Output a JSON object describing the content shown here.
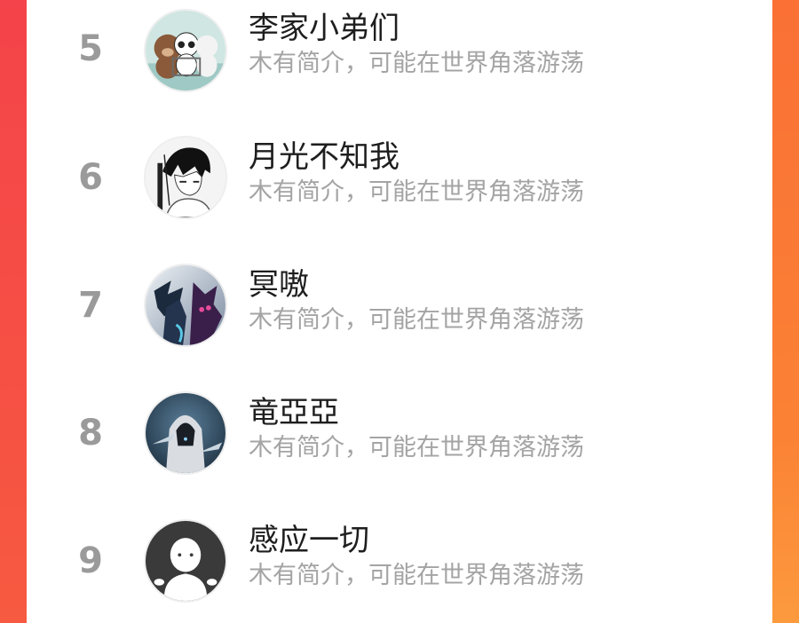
{
  "leaderboard": {
    "rows": [
      {
        "rank": "5",
        "name": "李家小弟们",
        "bio": "木有简介，可能在世界角落游荡",
        "avatar_icon": "bears-cartoon-avatar-icon"
      },
      {
        "rank": "6",
        "name": "月光不知我",
        "bio": "木有简介，可能在世界角落游荡",
        "avatar_icon": "manga-character-avatar-icon"
      },
      {
        "rank": "7",
        "name": "冥嗷",
        "bio": "木有简介，可能在世界角落游荡",
        "avatar_icon": "dark-armor-hero-avatar-icon"
      },
      {
        "rank": "8",
        "name": "竜亞亞",
        "bio": "木有简介，可能在世界角落游荡",
        "avatar_icon": "hooded-assassin-avatar-icon"
      },
      {
        "rank": "9",
        "name": "感应一切",
        "bio": "木有简介，可能在世界角落游荡",
        "avatar_icon": "default-user-avatar-icon"
      }
    ]
  },
  "colors": {
    "left_border": "#f4434a",
    "right_border": "#fb8235",
    "rank_text": "#9a9a9a",
    "name_text": "#1e1e1e",
    "bio_text": "#a4a4a4"
  }
}
